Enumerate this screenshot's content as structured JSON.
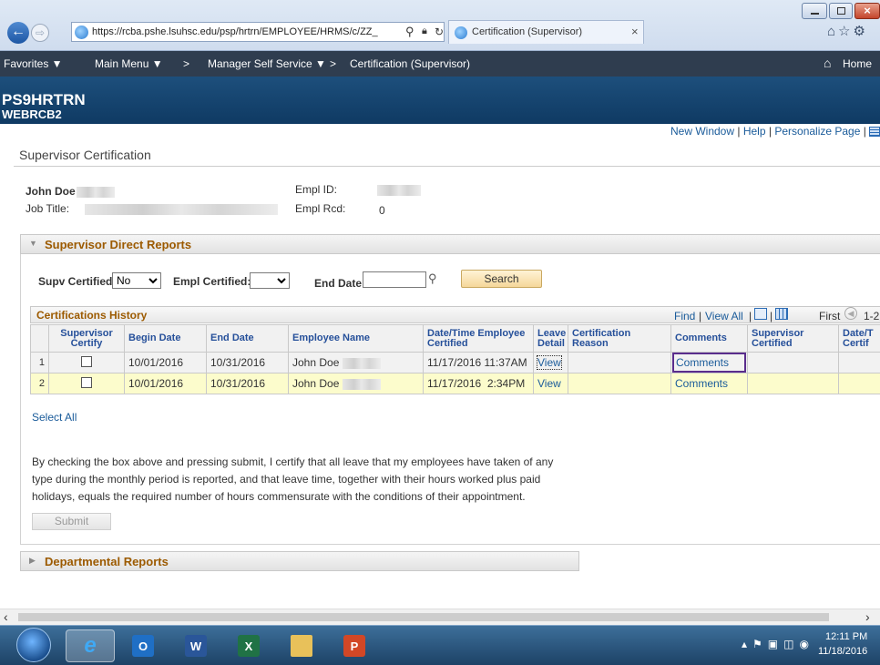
{
  "browser": {
    "url": "https://rcba.pshe.lsuhsc.edu/psp/hrtrn/EMPLOYEE/HRMS/c/ZZ_",
    "tab_title": "Certification (Supervisor)",
    "tab_close": "×"
  },
  "nav": {
    "favorites": "Favorites ▼",
    "main_menu": "Main Menu ▼",
    "sep1": ">",
    "manager": "Manager Self Service ▼",
    "sep2": ">",
    "current": "Certification (Supervisor)",
    "home": "Home"
  },
  "header": {
    "db": "PS9HRTRN",
    "server": "WEBRCB2"
  },
  "top_links": {
    "new_window": "New Window",
    "sep": "|",
    "help": "Help",
    "personalize": "Personalize Page"
  },
  "page_title": "Supervisor Certification",
  "employee": {
    "name": "John Doe",
    "job_title_label": "Job Title:",
    "empl_id_label": "Empl ID:",
    "empl_rcd_label": "Empl Rcd:",
    "empl_rcd": "0"
  },
  "direct_reports": {
    "title": "Supervisor Direct Reports",
    "supv_certified_label": "Supv Certified:",
    "supv_certified_value": "No",
    "empl_certified_label": "Empl Certified:",
    "empl_certified_value": "",
    "end_date_label": "End Date",
    "end_date_value": "",
    "search_button": "Search"
  },
  "history": {
    "title": "Certifications History",
    "find": "Find",
    "view_all": "View All",
    "first": "First",
    "range": "1-2",
    "columns": [
      "Supervisor Certify",
      "Begin Date",
      "End Date",
      "Employee Name",
      "Date/Time Employee Certified",
      "Leave Detail",
      "Certification Reason",
      "Comments",
      "Supervisor Certified",
      "Date/T Certif"
    ],
    "rows": [
      {
        "num": "1",
        "begin": "10/01/2016",
        "end": "10/31/2016",
        "name": "John Doe",
        "certified": "11/17/2016 11:37AM",
        "leave": "View",
        "reason": "",
        "comments": "Comments",
        "supv": "",
        "date2": ""
      },
      {
        "num": "2",
        "begin": "10/01/2016",
        "end": "10/31/2016",
        "name": "John Doe",
        "certified": "11/17/2016  2:34PM",
        "leave": "View",
        "reason": "",
        "comments": "Comments",
        "supv": "",
        "date2": ""
      }
    ]
  },
  "select_all": "Select All",
  "certify_text": [
    "By checking the box above and pressing submit, I certify that all leave that my employees have taken of any",
    "type during the monthly period is reported, and that leave time, together with their hours worked plus paid",
    "holidays, equals the required number of hours commensurate with the conditions of their appointment."
  ],
  "submit_button": "Submit",
  "departmental": {
    "title": "Departmental Reports"
  },
  "taskbar": {
    "time": "12:11 PM",
    "date": "11/18/2016"
  },
  "colors": {
    "nav_bg": "#2f3d4f",
    "header_bg": "#0f3a63",
    "section_title": "#9c5a00",
    "row_highlight": "#fcfccc",
    "focus_border": "#5a2d8c"
  }
}
